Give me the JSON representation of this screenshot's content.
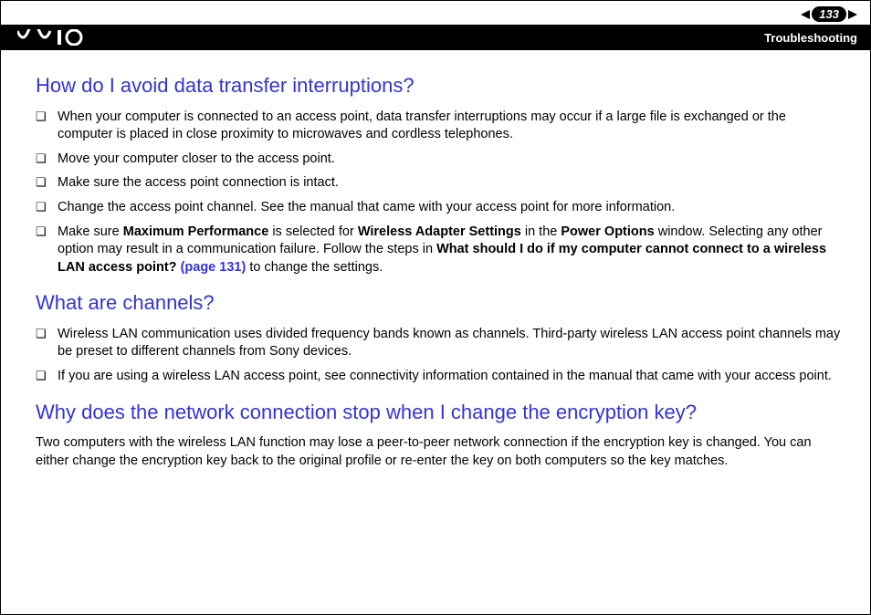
{
  "header": {
    "page_number": "133",
    "section": "Troubleshooting",
    "logo_text": "VAIO"
  },
  "sections": {
    "q1": {
      "title": "How do I avoid data transfer interruptions?",
      "items": [
        "When your computer is connected to an access point, data transfer interruptions may occur if a large file is exchanged or the computer is placed in close proximity to microwaves and cordless telephones.",
        "Move your computer closer to the access point.",
        "Make sure the access point connection is intact.",
        "Change the access point channel. See the manual that came with your access point for more information."
      ],
      "item5": {
        "t1": "Make sure ",
        "b1": "Maximum Performance",
        "t2": " is selected for ",
        "b2": "Wireless Adapter Settings",
        "t3": " in the ",
        "b3": "Power Options",
        "t4": " window. Selecting any other option may result in a communication failure. Follow the steps in ",
        "b4": "What should I do if my computer cannot connect to a wireless LAN access point? ",
        "link": "(page 131)",
        "t5": " to change the settings."
      }
    },
    "q2": {
      "title": "What are channels?",
      "items": [
        "Wireless LAN communication uses divided frequency bands known as channels. Third-party wireless LAN access point channels may be preset to different channels from Sony devices.",
        "If you are using a wireless LAN access point, see connectivity information contained in the manual that came with your access point."
      ]
    },
    "q3": {
      "title": "Why does the network connection stop when I change the encryption key?",
      "para": "Two computers with the wireless LAN function may lose a peer-to-peer network connection if the encryption key is changed. You can either change the encryption key back to the original profile or re-enter the key on both computers so the key matches."
    }
  }
}
